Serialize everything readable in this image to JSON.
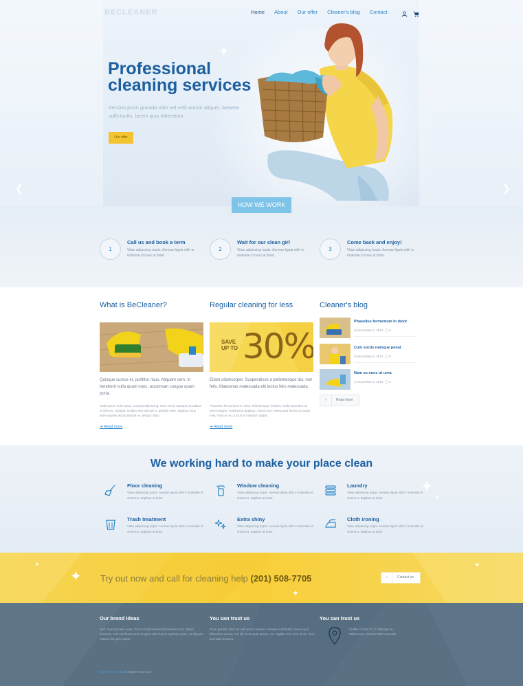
{
  "header": {
    "logo": "BECLEANER",
    "nav": [
      "Home",
      "About",
      "Our offer",
      "Cleaner's blog",
      "Contact"
    ],
    "icons": [
      "user-icon",
      "cart-icon"
    ]
  },
  "hero": {
    "title": "Professional cleaning services",
    "text": "Version proin gravida nibh vel velit auctor aliquet. Aenean sollicitudin, lorem quis bibendum.",
    "button": "Our offer"
  },
  "how": {
    "button": "HOW WE WORK",
    "steps": [
      {
        "num": "1",
        "title": "Call us and book a term",
        "desc": "Vitae adipiscing turpis. Aenean ligula nibh in molestie id risus at dolor."
      },
      {
        "num": "2",
        "title": "Wait for our clean girl",
        "desc": "Vitae adipiscing turpis. Aenean ligula nibh in molestie id risus at dolor."
      },
      {
        "num": "3",
        "title": "Come back and enjoy!",
        "desc": "Vitae adipiscing turpis. Aenean ligula nibh in molestie id risus at dolor."
      }
    ]
  },
  "about": {
    "title": "What is BeCleaner?",
    "lead": "Quisque cursus et, porttitor risus. Aliquam sem. In hendrerit nulla quam nunc, accumsan congue quam porta.",
    "small": "Nulla ipsum dolor lacus, suscipit adipiscing. Cum sociis natoque penatibus et ultrices. volutpat. Nullam wisi ultricies a, gravida vitae, dapibus risus ante sodales lectus blandit eu, tempor diam.",
    "more": "Read more"
  },
  "offer": {
    "title": "Regular cleaning for less",
    "promo_small": "SAVE UP TO",
    "promo_big": "30%",
    "lead": "Etiam ullamcorper. Suspendisse a pellentesque dui, non felis. Maecenas malesuada elit lectus felis malesuada.",
    "small": "Phasellus fermentum in, dolor. Pellentesque facilisis. Nulla imperdiet sit amet magna. Vestibulum dapibus, mauris nec malesuada fames ac turpis velit, rhoncus eu, luctus et interdum adipis.",
    "more": "Read more"
  },
  "blog": {
    "title": "Cleaner's blog",
    "posts": [
      {
        "title": "Phasellus fermentum in dolor",
        "date": "November 6, 2014",
        "comments": "0"
      },
      {
        "title": "Cum sociis natoque penat",
        "date": "November 6, 2014",
        "comments": "0"
      },
      {
        "title": "Nam eu nunc ut urna",
        "date": "November 6, 2014",
        "comments": "0"
      }
    ],
    "button": "Read more"
  },
  "services": {
    "title": "We working hard to make your place clean",
    "items": [
      {
        "name": "Floor cleaning",
        "icon": "mop-icon",
        "desc": "Vitae adipiscing turpis. Aenean ligula nibh in molestie id viverra a. dapibus at dolor."
      },
      {
        "name": "Window cleaning",
        "icon": "spray-bottle-icon",
        "desc": "Vitae adipiscing turpis. Aenean ligula nibh in molestie id viverra a. dapibus at dolor."
      },
      {
        "name": "Laundry",
        "icon": "laundry-icon",
        "desc": "Vitae adipiscing turpis. Aenean ligula nibh in molestie id viverra a. dapibus at dolor."
      },
      {
        "name": "Trash treatment",
        "icon": "trash-icon",
        "desc": "Vitae adipiscing turpis. Aenean ligula nibh in molestie id viverra a. dapibus at dolor."
      },
      {
        "name": "Extra shiny",
        "icon": "sparkles-icon",
        "desc": "Vitae adipiscing turpis. Aenean ligula nibh in molestie id viverra a. dapibus at dolor."
      },
      {
        "name": "Cloth ironing",
        "icon": "iron-icon",
        "desc": "Vitae adipiscing turpis. Aenean ligula nibh in molestie id viverra a. dapibus at dolor."
      }
    ]
  },
  "cta": {
    "text": "Try out now and call for cleaning help",
    "phone": "(201) 508-7705",
    "button": "Contact us"
  },
  "footer": {
    "col1_title": "Our brand ideas",
    "col1_text": "Sed ut perspiciatis unde. Proin condimentum fermentum nunc. Etiam pharetra, erat sed fermentum feugiat, velit mauris egestas quam, ut aliquam massa nisl quis neque.",
    "col2_title": "You can trust us",
    "col2_text": "Proin gravida nibh vel velit auctor aliquet. Aenean sollicitudin, lorem quis bibendum auctor, nisi elit consequat ipsum, nec sagittis sem nibh id elit. Duis sed odio sit amet.",
    "col3_title": "You can trust us",
    "address": "Cutlike Constr 27, 2 Gillespie St, Melbourne, Victoria 3000 Australia",
    "copyright_brand": "COMPANY.COM",
    "copyright_text": " All Rights Reserved"
  },
  "colors": {
    "accent_blue": "#1c5fa0",
    "link_blue": "#2a86c8",
    "yellow": "#f4c430",
    "footer_bg": "#5a7184"
  }
}
